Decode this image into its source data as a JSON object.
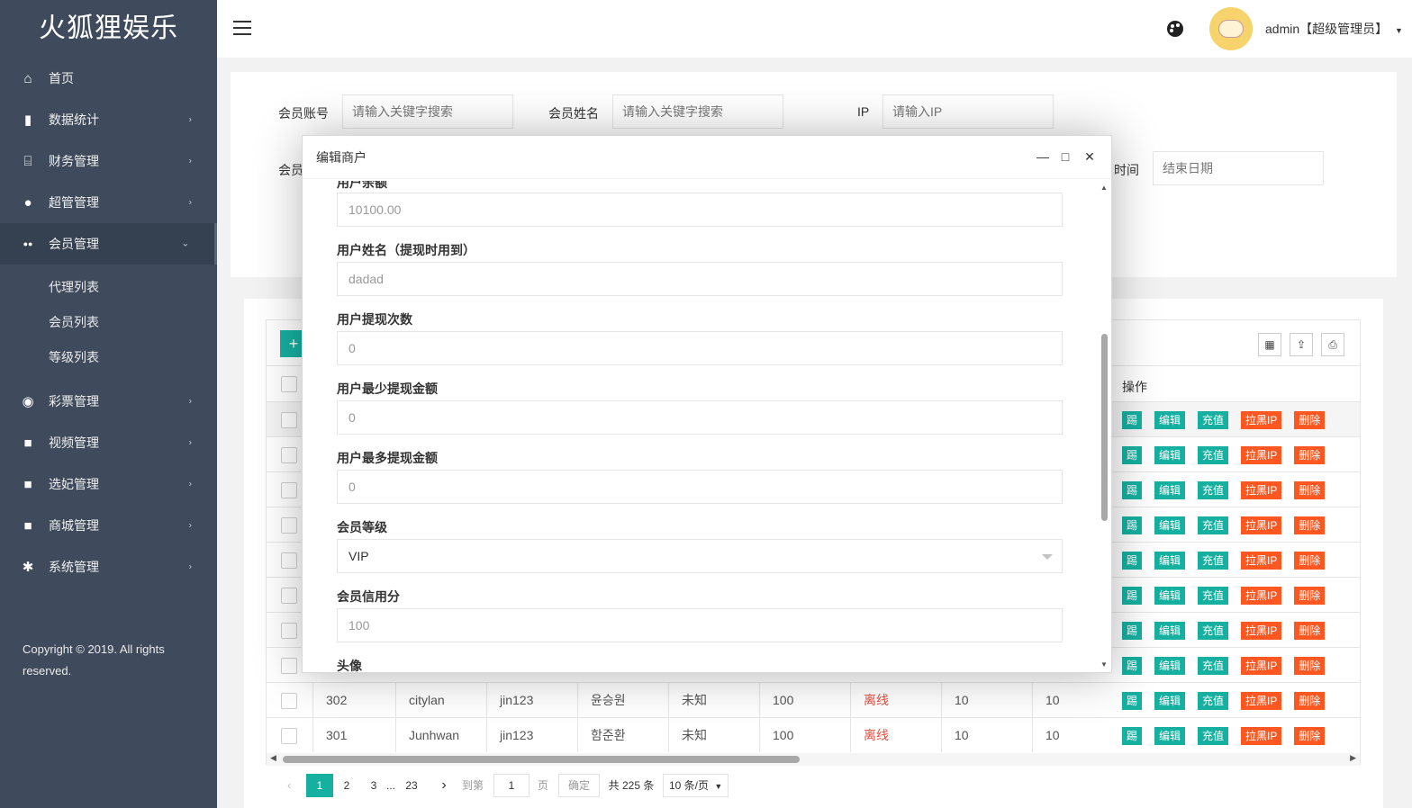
{
  "app": {
    "logo": "火狐狸娱乐",
    "copyright": "Copyright © 2019. All rights reserved."
  },
  "sidebar": {
    "items": [
      {
        "label": "首页",
        "icon": "home-icon",
        "glyph": "⌂"
      },
      {
        "label": "数据统计",
        "icon": "bar-chart-icon",
        "glyph": "▮"
      },
      {
        "label": "财务管理",
        "icon": "bank-icon",
        "glyph": "⌸"
      },
      {
        "label": "超管管理",
        "icon": "user-icon",
        "glyph": "●"
      },
      {
        "label": "会员管理",
        "icon": "users-icon",
        "glyph": "●●"
      },
      {
        "label": "彩票管理",
        "icon": "gamepad-icon",
        "glyph": "◉"
      },
      {
        "label": "视频管理",
        "icon": "video-icon",
        "glyph": "■"
      },
      {
        "label": "选妃管理",
        "icon": "video-icon",
        "glyph": "■"
      },
      {
        "label": "商城管理",
        "icon": "video-icon",
        "glyph": "■"
      },
      {
        "label": "系统管理",
        "icon": "gear-icon",
        "glyph": "✱"
      }
    ],
    "sub_items": [
      "代理列表",
      "会员列表",
      "等级列表"
    ]
  },
  "header": {
    "user": "admin【超级管理员】"
  },
  "search": {
    "account_label": "会员账号",
    "account_placeholder": "请输入关键字搜索",
    "name_label": "会员姓名",
    "name_placeholder": "请输入关键字搜索",
    "ip_label": "IP",
    "ip_placeholder": "请输入IP",
    "second_row_label_left": "会员",
    "second_row_label_right": "时间",
    "end_date_placeholder": "结束日期"
  },
  "table": {
    "op_header": "操作",
    "ops": [
      "踢",
      "编辑",
      "充值",
      "拉黑IP",
      "删除"
    ],
    "visible_rows": [
      {
        "id": "302",
        "account": "citylan",
        "agent": "jin123",
        "name": "윤승원",
        "gender": "未知",
        "score": "100",
        "status": "离线",
        "c1": "10",
        "c2": "10"
      },
      {
        "id": "301",
        "account": "Junhwan",
        "agent": "jin123",
        "name": "함준환",
        "gender": "未知",
        "score": "100",
        "status": "离线",
        "c1": "10",
        "c2": "10"
      }
    ]
  },
  "pager": {
    "pages": [
      "1",
      "2",
      "3",
      "...",
      "23"
    ],
    "goto_label": "到第",
    "goto_value": "1",
    "page_unit": "页",
    "confirm": "确定",
    "total": "共 225 条",
    "per_page": "10 条/页"
  },
  "modal": {
    "title": "编辑商户",
    "fields": [
      {
        "label": "用户余额",
        "value": "10100.00"
      },
      {
        "label": "用户姓名（提现时用到）",
        "value": "dadad"
      },
      {
        "label": "用户提现次数",
        "value": "0"
      },
      {
        "label": "用户最少提现金额",
        "value": "0"
      },
      {
        "label": "用户最多提现金额",
        "value": "0"
      },
      {
        "label": "会员等级",
        "value": "VIP"
      },
      {
        "label": "会员信用分",
        "value": "100"
      },
      {
        "label": "头像",
        "value": ""
      }
    ]
  },
  "colors": {
    "sidebar": "#3f4b5c",
    "primary": "#16b0a0",
    "danger": "#ff5722"
  }
}
